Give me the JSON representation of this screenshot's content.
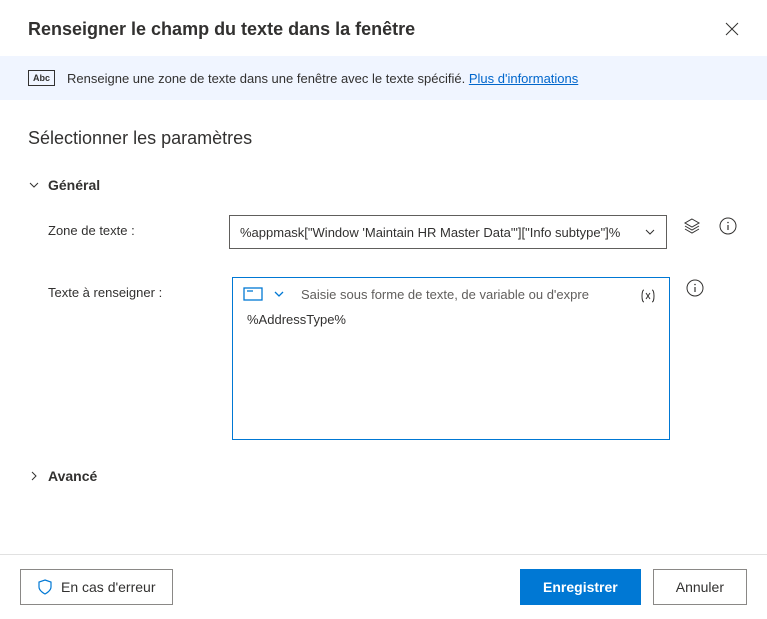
{
  "header": {
    "title": "Renseigner le champ du texte dans la fenêtre"
  },
  "info_banner": {
    "icon_label": "Abc",
    "text": "Renseigne une zone de texte dans une fenêtre avec le texte spécifié. ",
    "link_label": "Plus d'informations"
  },
  "section_title": "Sélectionner les paramètres",
  "sections": {
    "general": {
      "label": "Général"
    },
    "advanced": {
      "label": "Avancé"
    }
  },
  "form": {
    "text_box": {
      "label": "Zone de texte :",
      "value": "%appmask[\"Window 'Maintain HR Master Data'\"][\"Info subtype\"]%"
    },
    "text_to_fill": {
      "label": "Texte à renseigner :",
      "placeholder": "Saisie sous forme de texte, de variable ou d'expre",
      "value": "%AddressType%"
    }
  },
  "footer": {
    "error_label": "En cas d'erreur",
    "save_label": "Enregistrer",
    "cancel_label": "Annuler"
  }
}
